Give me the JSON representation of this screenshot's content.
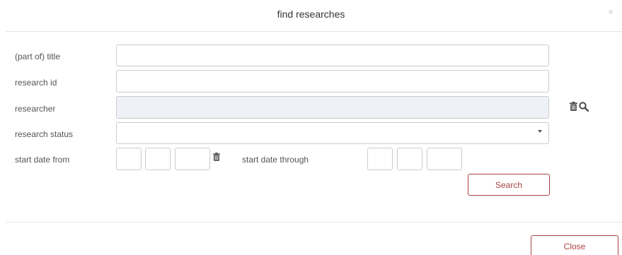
{
  "dialog": {
    "title": "find researches",
    "close_glyph": "×"
  },
  "form": {
    "title_label": "(part of) title",
    "title_value": "",
    "research_id_label": "research id",
    "research_id_value": "",
    "researcher_label": "researcher",
    "researcher_value": "",
    "status_label": "research status",
    "status_selected": "",
    "start_from_label": "start date from",
    "start_through_label": "start date through"
  },
  "buttons": {
    "search_label": "Search",
    "close_label": "Close"
  },
  "icons": {
    "researcher_clear": "trash-icon",
    "researcher_lookup": "search-icon",
    "date_clear": "trash-icon"
  },
  "colors": {
    "accent": "#a94442",
    "readonly_bg": "#eef1f5",
    "border": "#cccccc"
  }
}
